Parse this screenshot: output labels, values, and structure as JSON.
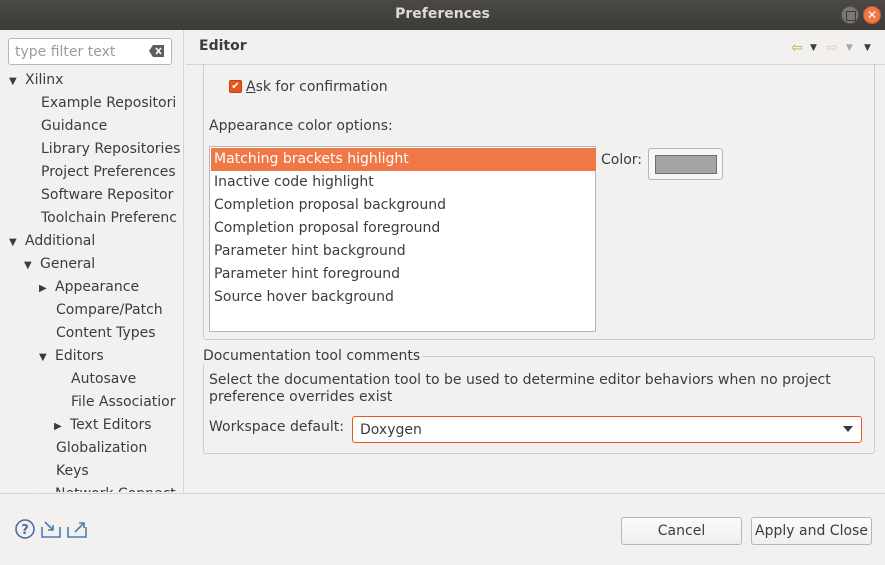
{
  "window": {
    "title": "Preferences"
  },
  "sidebar": {
    "filter_placeholder": "type filter text",
    "tree": [
      {
        "label": "Xilinx",
        "depth": 0,
        "expander": "expanded"
      },
      {
        "label": "Example Repositori",
        "depth": 1,
        "expander": "none"
      },
      {
        "label": "Guidance",
        "depth": 1,
        "expander": "none"
      },
      {
        "label": "Library Repositories",
        "depth": 1,
        "expander": "none"
      },
      {
        "label": "Project Preferences",
        "depth": 1,
        "expander": "none"
      },
      {
        "label": "Software Repositor",
        "depth": 1,
        "expander": "none"
      },
      {
        "label": "Toolchain Preferenc",
        "depth": 1,
        "expander": "none"
      },
      {
        "label": "Additional",
        "depth": 0,
        "expander": "expanded"
      },
      {
        "label": "General",
        "depth": 1,
        "expander": "expanded"
      },
      {
        "label": "Appearance",
        "depth": 2,
        "expander": "collapsed"
      },
      {
        "label": "Compare/Patch",
        "depth": 2,
        "expander": "none"
      },
      {
        "label": "Content Types",
        "depth": 2,
        "expander": "none"
      },
      {
        "label": "Editors",
        "depth": 2,
        "expander": "expanded"
      },
      {
        "label": "Autosave",
        "depth": 3,
        "expander": "none"
      },
      {
        "label": "File Associatior",
        "depth": 3,
        "expander": "none"
      },
      {
        "label": "Text Editors",
        "depth": 3,
        "expander": "collapsed"
      },
      {
        "label": "Globalization",
        "depth": 2,
        "expander": "none"
      },
      {
        "label": "Keys",
        "depth": 2,
        "expander": "none"
      },
      {
        "label": "Network Connect",
        "depth": 2,
        "expander": "collapsed"
      }
    ]
  },
  "header": {
    "title": "Editor"
  },
  "editor": {
    "confirm_checkbox": {
      "label_underlined": "A",
      "label_rest": "sk for confirmation",
      "checked": true
    },
    "appearance_label": "Appearance color options:",
    "color_options": [
      "Matching brackets highlight",
      "Inactive code highlight",
      "Completion proposal background",
      "Completion proposal foreground",
      "Parameter hint background",
      "Parameter hint foreground",
      "Source hover background"
    ],
    "selected_index": 0,
    "color_label": "Color:",
    "color_value": "#a5a5a5"
  },
  "doc_group": {
    "title": "Documentation tool comments",
    "description": "Select the documentation tool to be used to determine editor behaviors when no project preference overrides exist",
    "workspace_label": "Workspace default:",
    "workspace_value": "Doxygen"
  },
  "footer": {
    "cancel_label": "Cancel",
    "apply_close_label": "Apply and Close"
  },
  "colors": {
    "accent": "#e95420",
    "selection": "#f07746",
    "titlebar": "#3c3b37"
  }
}
